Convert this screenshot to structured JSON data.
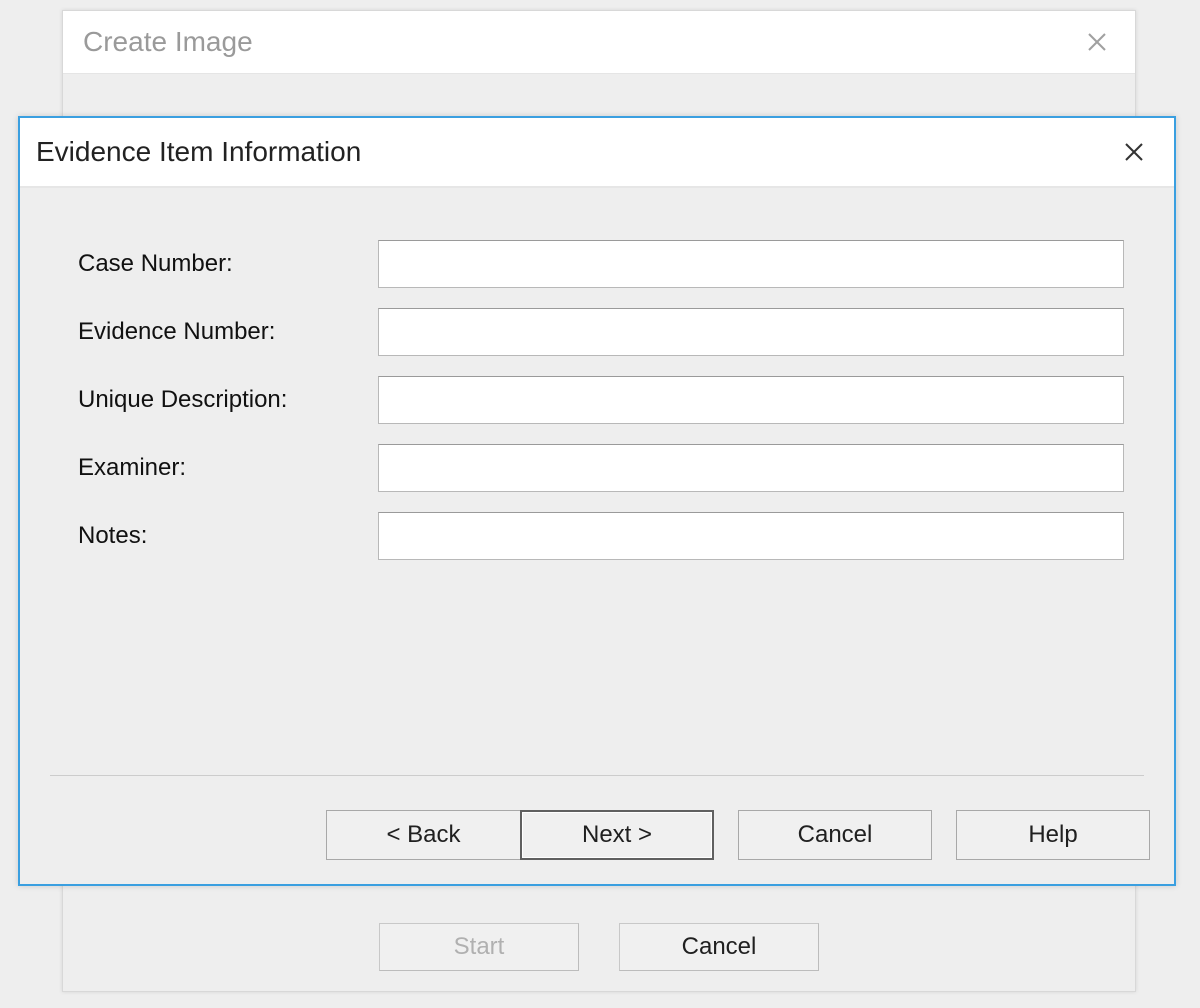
{
  "bg_dialog": {
    "title": "Create Image",
    "start_label": "Start",
    "cancel_label": "Cancel"
  },
  "fg_dialog": {
    "title": "Evidence Item Information",
    "fields": {
      "case_number_label": "Case Number:",
      "case_number_value": "",
      "evidence_number_label": "Evidence Number:",
      "evidence_number_value": "",
      "unique_description_label": "Unique Description:",
      "unique_description_value": "",
      "examiner_label": "Examiner:",
      "examiner_value": "",
      "notes_label": "Notes:",
      "notes_value": ""
    },
    "buttons": {
      "back": "< Back",
      "next": "Next >",
      "cancel": "Cancel",
      "help": "Help"
    }
  }
}
